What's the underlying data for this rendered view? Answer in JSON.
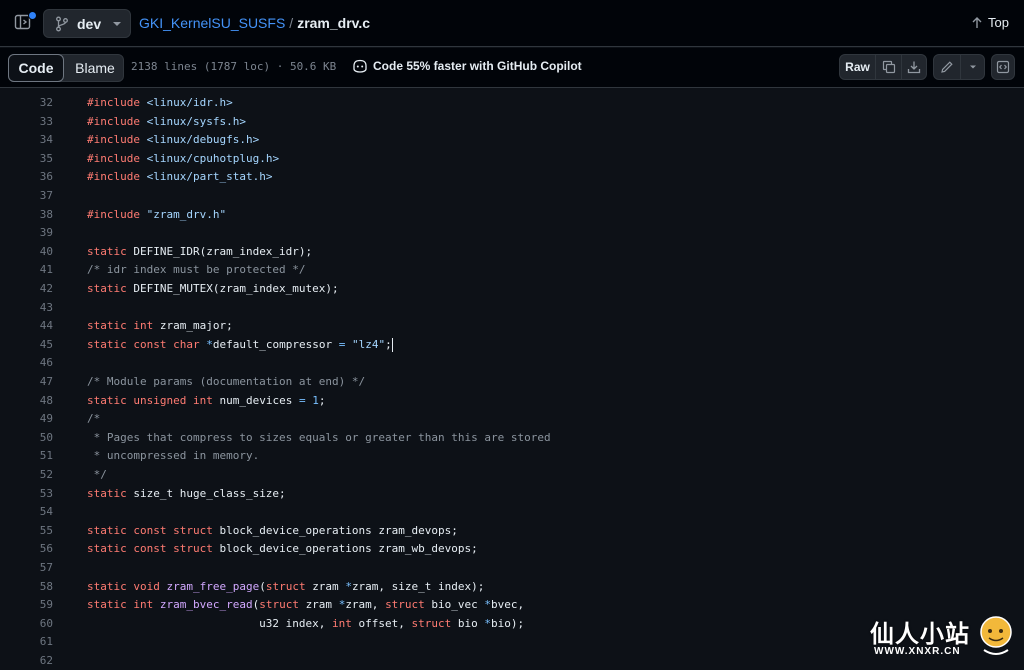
{
  "header": {
    "branch": "dev",
    "repo": "GKI_KernelSU_SUSFS",
    "separator": "/",
    "file": "zram_drv.c",
    "top_label": "Top"
  },
  "toolbar": {
    "code_tab": "Code",
    "blame_tab": "Blame",
    "file_info": "2138 lines (1787 loc) · 50.6 KB",
    "copilot": "Code 55% faster with GitHub Copilot",
    "raw": "Raw"
  },
  "colors": {
    "background": "#0d1117",
    "link": "#4493f8",
    "keyword": "#ff7b72",
    "string": "#a5d6ff",
    "comment": "#8b949e",
    "function": "#d2a8ff"
  },
  "code_lines": [
    {
      "n": "32",
      "tokens": [
        {
          "c": "kw",
          "t": "#include "
        },
        {
          "c": "str",
          "t": "<linux/idr.h>"
        }
      ]
    },
    {
      "n": "33",
      "tokens": [
        {
          "c": "kw",
          "t": "#include "
        },
        {
          "c": "str",
          "t": "<linux/sysfs.h>"
        }
      ]
    },
    {
      "n": "34",
      "tokens": [
        {
          "c": "kw",
          "t": "#include "
        },
        {
          "c": "str",
          "t": "<linux/debugfs.h>"
        }
      ]
    },
    {
      "n": "35",
      "tokens": [
        {
          "c": "kw",
          "t": "#include "
        },
        {
          "c": "str",
          "t": "<linux/cpuhotplug.h>"
        }
      ]
    },
    {
      "n": "36",
      "tokens": [
        {
          "c": "kw",
          "t": "#include "
        },
        {
          "c": "str",
          "t": "<linux/part_stat.h>"
        }
      ]
    },
    {
      "n": "37",
      "tokens": []
    },
    {
      "n": "38",
      "tokens": [
        {
          "c": "kw",
          "t": "#include "
        },
        {
          "c": "str",
          "t": "\"zram_drv.h\""
        }
      ]
    },
    {
      "n": "39",
      "tokens": []
    },
    {
      "n": "40",
      "tokens": [
        {
          "c": "kw",
          "t": "static "
        },
        {
          "c": "",
          "t": "DEFINE_IDR(zram_index_idr);"
        }
      ]
    },
    {
      "n": "41",
      "tokens": [
        {
          "c": "cm",
          "t": "/* idr index must be protected */"
        }
      ]
    },
    {
      "n": "42",
      "tokens": [
        {
          "c": "kw",
          "t": "static "
        },
        {
          "c": "",
          "t": "DEFINE_MUTEX(zram_index_mutex);"
        }
      ]
    },
    {
      "n": "43",
      "tokens": []
    },
    {
      "n": "44",
      "tokens": [
        {
          "c": "kw",
          "t": "static "
        },
        {
          "c": "kw",
          "t": "int "
        },
        {
          "c": "",
          "t": "zram_major;"
        }
      ]
    },
    {
      "n": "45",
      "tokens": [
        {
          "c": "kw",
          "t": "static "
        },
        {
          "c": "kw",
          "t": "const "
        },
        {
          "c": "kw",
          "t": "char "
        },
        {
          "c": "op",
          "t": "*"
        },
        {
          "c": "",
          "t": "default_compressor "
        },
        {
          "c": "op",
          "t": "= "
        },
        {
          "c": "str",
          "t": "\"lz4\""
        },
        {
          "c": "",
          "t": ";"
        }
      ],
      "cursor": true
    },
    {
      "n": "46",
      "tokens": []
    },
    {
      "n": "47",
      "tokens": [
        {
          "c": "cm",
          "t": "/* Module params (documentation at end) */"
        }
      ]
    },
    {
      "n": "48",
      "tokens": [
        {
          "c": "kw",
          "t": "static "
        },
        {
          "c": "kw",
          "t": "unsigned "
        },
        {
          "c": "kw",
          "t": "int "
        },
        {
          "c": "",
          "t": "num_devices "
        },
        {
          "c": "op",
          "t": "= "
        },
        {
          "c": "num",
          "t": "1"
        },
        {
          "c": "",
          "t": ";"
        }
      ]
    },
    {
      "n": "49",
      "tokens": [
        {
          "c": "cm",
          "t": "/*"
        }
      ]
    },
    {
      "n": "50",
      "tokens": [
        {
          "c": "cm",
          "t": " * Pages that compress to sizes equals or greater than this are stored"
        }
      ]
    },
    {
      "n": "51",
      "tokens": [
        {
          "c": "cm",
          "t": " * uncompressed in memory."
        }
      ]
    },
    {
      "n": "52",
      "tokens": [
        {
          "c": "cm",
          "t": " */"
        }
      ]
    },
    {
      "n": "53",
      "tokens": [
        {
          "c": "kw",
          "t": "static "
        },
        {
          "c": "",
          "t": "size_t huge_class_size;"
        }
      ]
    },
    {
      "n": "54",
      "tokens": []
    },
    {
      "n": "55",
      "tokens": [
        {
          "c": "kw",
          "t": "static "
        },
        {
          "c": "kw",
          "t": "const "
        },
        {
          "c": "kw",
          "t": "struct "
        },
        {
          "c": "",
          "t": "block_device_operations zram_devops;"
        }
      ]
    },
    {
      "n": "56",
      "tokens": [
        {
          "c": "kw",
          "t": "static "
        },
        {
          "c": "kw",
          "t": "const "
        },
        {
          "c": "kw",
          "t": "struct "
        },
        {
          "c": "",
          "t": "block_device_operations zram_wb_devops;"
        }
      ]
    },
    {
      "n": "57",
      "tokens": []
    },
    {
      "n": "58",
      "tokens": [
        {
          "c": "kw",
          "t": "static "
        },
        {
          "c": "kw",
          "t": "void "
        },
        {
          "c": "fn",
          "t": "zram_free_page"
        },
        {
          "c": "",
          "t": "("
        },
        {
          "c": "kw",
          "t": "struct "
        },
        {
          "c": "",
          "t": "zram "
        },
        {
          "c": "op",
          "t": "*"
        },
        {
          "c": "",
          "t": "zram, size_t index);"
        }
      ]
    },
    {
      "n": "59",
      "tokens": [
        {
          "c": "kw",
          "t": "static "
        },
        {
          "c": "kw",
          "t": "int "
        },
        {
          "c": "fn",
          "t": "zram_bvec_read"
        },
        {
          "c": "",
          "t": "("
        },
        {
          "c": "kw",
          "t": "struct "
        },
        {
          "c": "",
          "t": "zram "
        },
        {
          "c": "op",
          "t": "*"
        },
        {
          "c": "",
          "t": "zram, "
        },
        {
          "c": "kw",
          "t": "struct "
        },
        {
          "c": "",
          "t": "bio_vec "
        },
        {
          "c": "op",
          "t": "*"
        },
        {
          "c": "",
          "t": "bvec,"
        }
      ]
    },
    {
      "n": "60",
      "tokens": [
        {
          "c": "",
          "t": "                          u32 index, "
        },
        {
          "c": "kw",
          "t": "int "
        },
        {
          "c": "",
          "t": "offset, "
        },
        {
          "c": "kw",
          "t": "struct "
        },
        {
          "c": "",
          "t": "bio "
        },
        {
          "c": "op",
          "t": "*"
        },
        {
          "c": "",
          "t": "bio);"
        }
      ]
    },
    {
      "n": "61",
      "tokens": []
    },
    {
      "n": "62",
      "tokens": []
    }
  ],
  "watermark": {
    "title": "仙人小站",
    "url": "WWW.XNXR.CN"
  }
}
